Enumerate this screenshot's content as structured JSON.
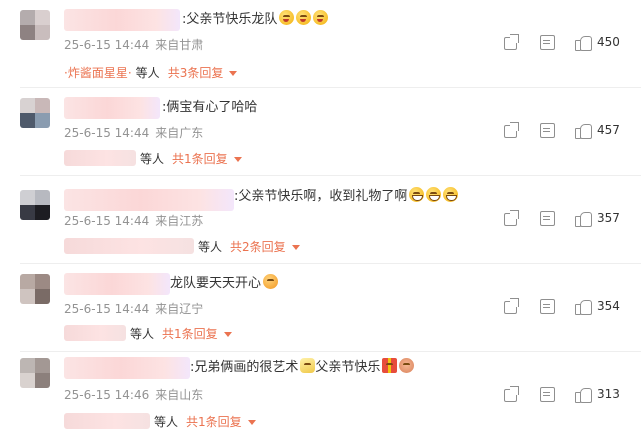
{
  "comments": [
    {
      "text": ":父亲节快乐龙队",
      "emojis": [
        "blush-emoji",
        "blush-emoji",
        "blush-emoji"
      ],
      "time": "25-6-15 14:44",
      "location": "来自甘肃",
      "likes": "450",
      "reply_name": "炸酱面星星",
      "reply_sep_left": "·",
      "reply_sep_right": "·",
      "reply_others": "等人",
      "reply_count": "共3条回复"
    },
    {
      "text": ":俩宝有心了哈哈",
      "emojis": [],
      "time": "25-6-15 14:44",
      "location": "来自广东",
      "likes": "457",
      "reply_others": "等人",
      "reply_count": "共1条回复"
    },
    {
      "text": ":父亲节快乐啊，收到礼物了啊",
      "emojis": [
        "grin-emoji",
        "grin-emoji",
        "grin-emoji"
      ],
      "time": "25-6-15 14:44",
      "location": "来自江苏",
      "likes": "357",
      "reply_others": "等人",
      "reply_count": "共2条回复"
    },
    {
      "text": "龙队要天天开心",
      "emojis": [
        "party-emoji"
      ],
      "time": "25-6-15 14:44",
      "location": "来自辽宁",
      "likes": "354",
      "reply_others": "等人",
      "reply_count": "共1条回复"
    },
    {
      "text": ":兄弟俩画的很艺术",
      "text2": "父亲节快乐",
      "emojis": [
        "clap-emoji",
        "gift-emoji",
        "bear-emoji"
      ],
      "time": "25-6-15 14:46",
      "location": "来自山东",
      "likes": "313",
      "reply_others": "等人",
      "reply_count": "共1条回复"
    }
  ],
  "colors": {
    "accent": "#eb7350",
    "meta_text": "#939393",
    "body_text": "#333333",
    "icon": "#8f8f8f"
  },
  "icons": [
    "share-icon",
    "comment-icon",
    "like-icon",
    "caret-down-icon"
  ]
}
